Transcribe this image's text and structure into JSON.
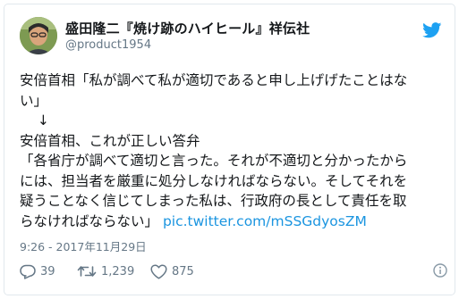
{
  "tweet": {
    "author_name": "盛田隆二『焼け跡のハイヒール』祥伝社",
    "author_handle": "@product1954",
    "body_lines": [
      "安倍首相「私が調べて私が適切であると申し上げげたことはな",
      "い」",
      "↓",
      "安倍首相、これが正しい答弁",
      "「各省庁が調べて適切と言った。それが不適切と分かったから",
      "には、担当者を厳重に処分しなければならない。そしてそれを",
      "疑うことなく信じてしまった私は、行政府の長として責任を取",
      "らなければならない」"
    ],
    "link_text": "pic.twitter.com/mSSGdyosZM",
    "timestamp": "9:26 - 2017年11月29日",
    "reply_count": "39",
    "retweet_count": "1,239",
    "like_count": "875"
  },
  "colors": {
    "twitter_blue": "#1da1f2",
    "link_blue": "#1b95e0",
    "meta_gray": "#657786"
  },
  "icons": {
    "logo": "twitter-bird-icon",
    "reply": "reply-icon",
    "retweet": "retweet-icon",
    "like": "heart-icon",
    "info": "info-icon"
  }
}
